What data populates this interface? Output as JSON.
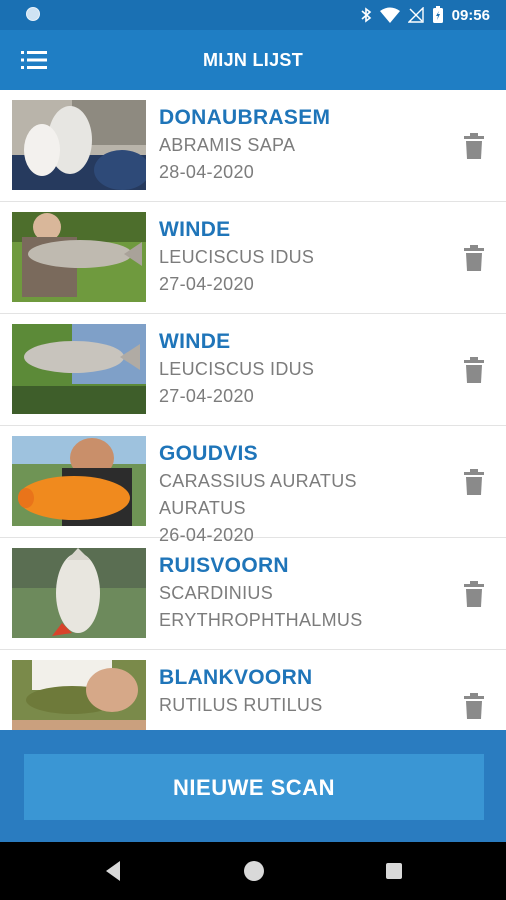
{
  "status_bar": {
    "time": "09:56"
  },
  "header": {
    "title": "MIJN LIJST",
    "menu_icon": "hamburger-menu-icon"
  },
  "catches": [
    {
      "name": "DONAUBRASEM",
      "latin": "ABRAMIS SAPA",
      "date": "28-04-2020"
    },
    {
      "name": "WINDE",
      "latin": "LEUCISCUS IDUS",
      "date": "27-04-2020"
    },
    {
      "name": "WINDE",
      "latin": "LEUCISCUS IDUS",
      "date": "27-04-2020"
    },
    {
      "name": "GOUDVIS",
      "latin": "CARASSIUS AURATUS AURATUS",
      "date": "26-04-2020"
    },
    {
      "name": "RUISVOORN",
      "latin": "SCARDINIUS ERYTHROPHTHALMUS",
      "date": ""
    },
    {
      "name": "BLANKVOORN",
      "latin": "RUTILUS RUTILUS",
      "date": ""
    }
  ],
  "actions": {
    "new_scan_label": "NIEUWE SCAN"
  },
  "colors": {
    "status_bar": "#1a70b3",
    "app_bar": "#1f7ec4",
    "accent_text": "#1f75b9",
    "scan_button": "#3a96d4",
    "bottom_panel": "#2a7cc0"
  }
}
